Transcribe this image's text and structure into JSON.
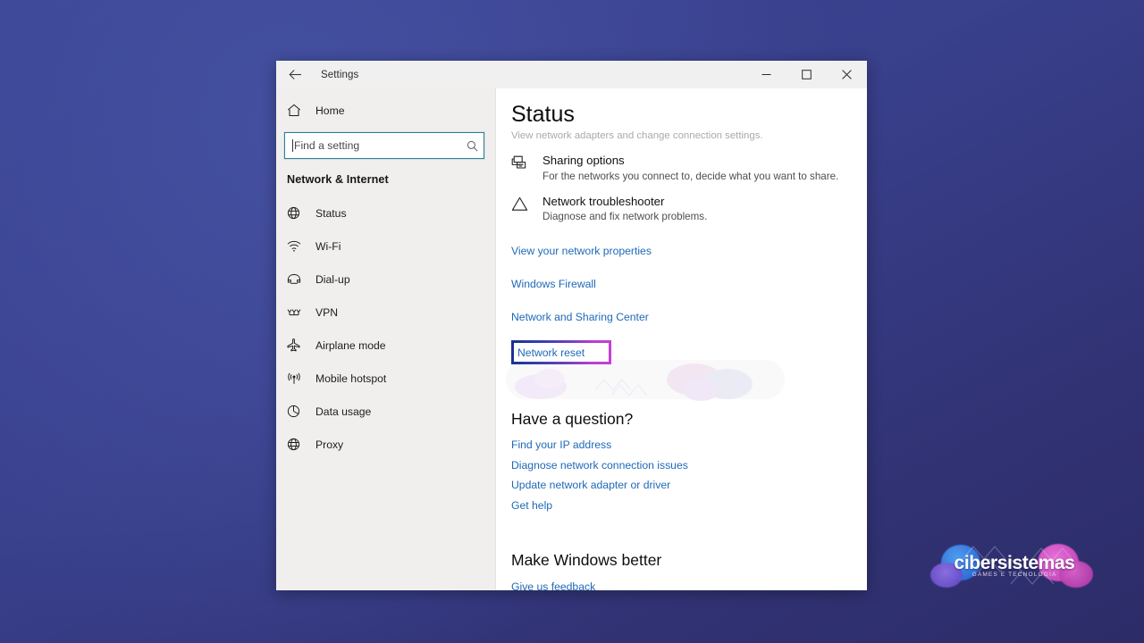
{
  "window": {
    "title": "Settings",
    "back_icon": "back-arrow-icon",
    "controls": {
      "minimize": "minimize-icon",
      "maximize": "maximize-icon",
      "close": "close-icon"
    }
  },
  "sidebar": {
    "home": {
      "label": "Home",
      "icon": "home-icon"
    },
    "search": {
      "placeholder": "Find a setting",
      "value": "",
      "icon": "search-icon"
    },
    "category_title": "Network & Internet",
    "items": [
      {
        "label": "Status",
        "icon": "globe-status-icon",
        "selected": true
      },
      {
        "label": "Wi-Fi",
        "icon": "wifi-icon",
        "selected": false
      },
      {
        "label": "Dial-up",
        "icon": "dialup-phone-icon",
        "selected": false
      },
      {
        "label": "VPN",
        "icon": "vpn-icon",
        "selected": false
      },
      {
        "label": "Airplane mode",
        "icon": "airplane-icon",
        "selected": false
      },
      {
        "label": "Mobile hotspot",
        "icon": "hotspot-icon",
        "selected": false
      },
      {
        "label": "Data usage",
        "icon": "data-usage-pie-icon",
        "selected": false
      },
      {
        "label": "Proxy",
        "icon": "proxy-globe-icon",
        "selected": false
      }
    ]
  },
  "content": {
    "page_title": "Status",
    "clipped_line": "View network adapters and change connection settings.",
    "features": [
      {
        "title": "Sharing options",
        "desc": "For the networks you connect to, decide what you want to share.",
        "icon": "sharing-options-icon"
      },
      {
        "title": "Network troubleshooter",
        "desc": "Diagnose and fix network problems.",
        "icon": "warning-triangle-icon"
      }
    ],
    "links": [
      "View your network properties",
      "Windows Firewall",
      "Network and Sharing Center"
    ],
    "highlighted_link": {
      "label": "Network reset",
      "annotation": "highlight-box",
      "border_gradient_from": "#1b2f8f",
      "border_gradient_to": "#c83fd8"
    },
    "question_section": {
      "heading": "Have a question?",
      "links": [
        "Find your IP address",
        "Diagnose network connection issues",
        "Update network adapter or driver",
        "Get help"
      ]
    },
    "feedback_section": {
      "heading": "Make Windows better",
      "links": [
        "Give us feedback"
      ]
    }
  },
  "brand": {
    "name": "cibersistemas",
    "tagline": "GAMES E TECNOLOGIA",
    "blue": "#2f6fd8",
    "pink": "#c648bc"
  },
  "theme": {
    "link_color": "#1e69b8",
    "sidebar_bg": "#f0efee",
    "search_focus_border": "#2d7d9a",
    "desktop_blue": "#3b4596"
  }
}
